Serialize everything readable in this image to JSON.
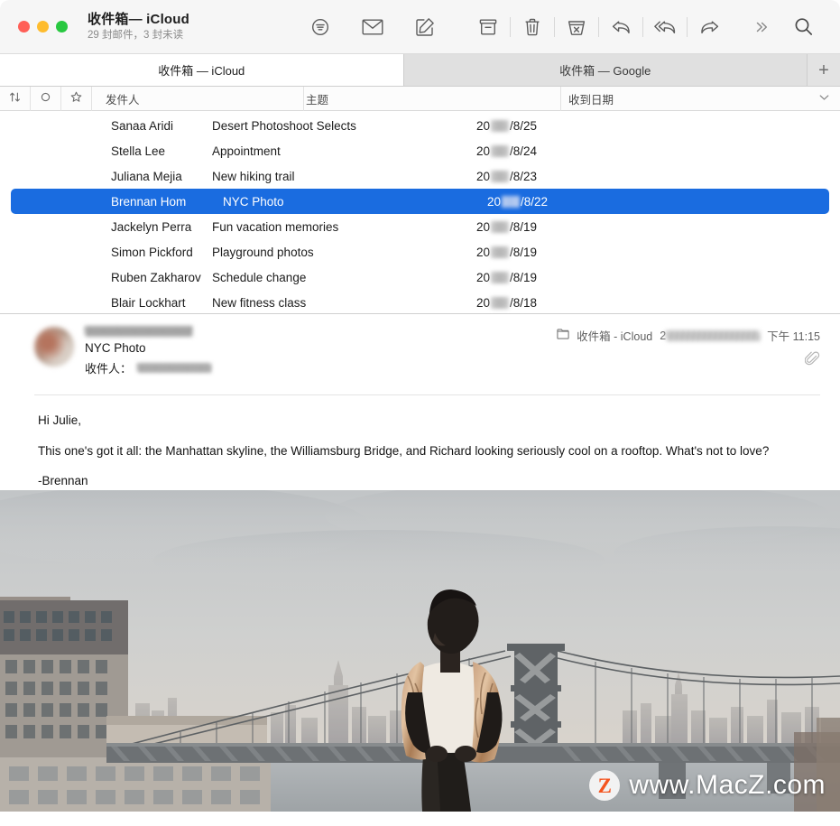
{
  "window": {
    "title": "收件箱— iCloud",
    "subtitle": "29 封邮件，3 封未读",
    "traffic": {
      "close": "close-button",
      "minimize": "minimize-button",
      "zoom": "zoom-button"
    }
  },
  "toolbar": {
    "buttons": [
      {
        "name": "filter-icon",
        "label": "筛选"
      },
      {
        "name": "get-mail-icon",
        "label": "接收新邮件"
      },
      {
        "name": "compose-icon",
        "label": "撰写新邮件"
      },
      {
        "name": "archive-icon",
        "label": "归档"
      },
      {
        "name": "trash-icon",
        "label": "删除"
      },
      {
        "name": "junk-icon",
        "label": "标为垃圾邮件"
      },
      {
        "name": "reply-icon",
        "label": "回复"
      },
      {
        "name": "reply-all-icon",
        "label": "全部回复"
      },
      {
        "name": "forward-icon",
        "label": "转发"
      },
      {
        "name": "more-icon",
        "label": "更多"
      },
      {
        "name": "search-icon",
        "label": "搜索"
      }
    ]
  },
  "tabs": {
    "items": [
      {
        "label": "收件箱 — iCloud",
        "active": true
      },
      {
        "label": "收件箱 — Google",
        "active": false
      }
    ],
    "add_label": "+"
  },
  "columns": {
    "sort_icon": "↑↓",
    "unread_icon": "○",
    "flag_icon": "☆",
    "sender": "发件人",
    "subject": "主题",
    "date": "收到日期",
    "sort_chevron": "⌄"
  },
  "messages": [
    {
      "sender": "Sanaa Aridi",
      "subject": "Desert Photoshoot Selects",
      "date_prefix": "20",
      "date_suffix": "/8/25",
      "selected": false
    },
    {
      "sender": "Stella Lee",
      "subject": "Appointment",
      "date_prefix": "20",
      "date_suffix": "/8/24",
      "selected": false
    },
    {
      "sender": "Juliana Mejia",
      "subject": "New hiking trail",
      "date_prefix": "20",
      "date_suffix": "/8/23",
      "selected": false
    },
    {
      "sender": "Brennan Hom",
      "subject": "NYC Photo",
      "date_prefix": "20",
      "date_suffix": "/8/22",
      "selected": true
    },
    {
      "sender": "Jackelyn Perra",
      "subject": "Fun vacation memories",
      "date_prefix": "20",
      "date_suffix": "/8/19",
      "selected": false
    },
    {
      "sender": "Simon Pickford",
      "subject": "Playground photos",
      "date_prefix": "20",
      "date_suffix": "/8/19",
      "selected": false
    },
    {
      "sender": "Ruben Zakharov",
      "subject": "Schedule change",
      "date_prefix": "20",
      "date_suffix": "/8/19",
      "selected": false
    },
    {
      "sender": "Blair Lockhart",
      "subject": "New fitness class",
      "date_prefix": "20",
      "date_suffix": "/8/18",
      "selected": false
    }
  ],
  "message_header": {
    "sender_redacted": true,
    "subject": "NYC Photo",
    "to_label": "收件人：",
    "to_redacted": true,
    "folder_icon": "folder-icon",
    "folder": "收件箱 - iCloud",
    "date_redacted_prefix": "2",
    "time": "下午 11:15",
    "attachment_icon": "paperclip-icon"
  },
  "message_body": {
    "greeting": "Hi Julie,",
    "paragraph": "This one's got it all: the Manhattan skyline, the Williamsburg Bridge, and Richard looking seriously cool on a rooftop. What's not to love?",
    "signature": "-Brennan"
  },
  "photo": {
    "alt": "Man on a Brooklyn rooftop with the Williamsburg Bridge and Manhattan skyline behind him"
  },
  "watermark": {
    "logo_letter": "Z",
    "text": "www.MacZ.com",
    "accent": "#f4541f"
  },
  "colors": {
    "selection_blue": "#1a6ce0",
    "toolbar_bg": "#f6f6f6",
    "tab_active_bg": "#ffffff",
    "tab_inactive_bg": "#e0e0e0"
  }
}
